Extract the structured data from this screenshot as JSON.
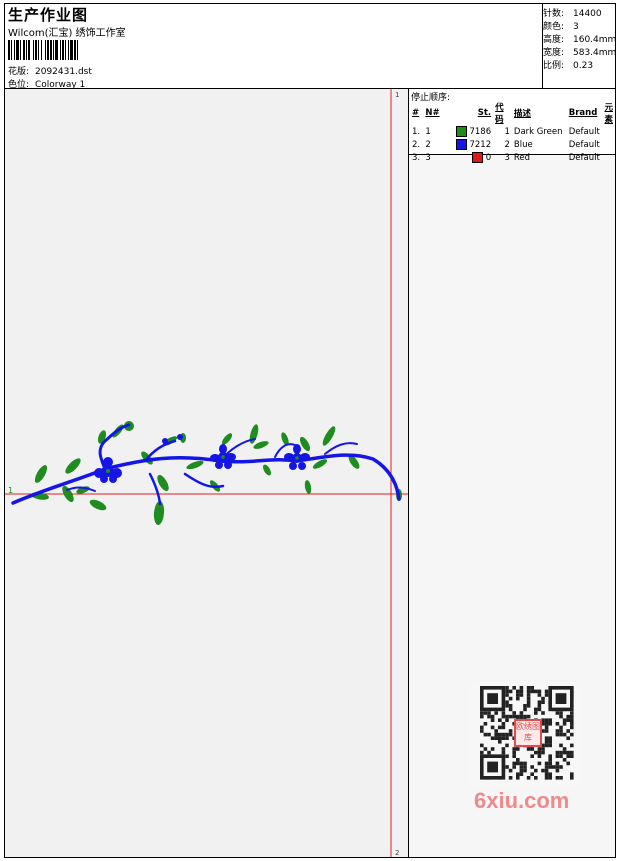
{
  "header": {
    "title": "生产作业图",
    "company": "Wilcom(汇宝) 绣饰工作室",
    "design_label": "花版:",
    "design_value": "2092431.dst",
    "colorway_label": "色位:",
    "colorway_value": "Colorway 1"
  },
  "specs": [
    {
      "label": "针数:",
      "value": "14400"
    },
    {
      "label": "颜色:",
      "value": "3"
    },
    {
      "label": "高度:",
      "value": "160.4mm"
    },
    {
      "label": "宽度:",
      "value": "583.4mm"
    },
    {
      "label": "比例:",
      "value": "0.23"
    }
  ],
  "stop_sequence": {
    "title": "停止顺序:",
    "columns": [
      "#",
      "N#",
      "St.",
      "代码",
      "描述",
      "Brand",
      "元素"
    ],
    "rows": [
      {
        "index": "1.",
        "n": "1",
        "color": "#1e8c1e",
        "stitches": "7186",
        "code": "1",
        "desc": "Dark Green",
        "brand": "Default",
        "element": ""
      },
      {
        "index": "2.",
        "n": "2",
        "color": "#1515e6",
        "stitches": "7212",
        "code": "2",
        "desc": "Blue",
        "brand": "Default",
        "element": ""
      },
      {
        "index": "3.",
        "n": "3",
        "color": "#e01818",
        "stitches": "0",
        "code": "3",
        "desc": "Red",
        "brand": "Default",
        "element": ""
      }
    ]
  },
  "canvas": {
    "start_marker": "1",
    "end_marker": "2",
    "guide_color": "#e02020"
  },
  "watermark": {
    "site": "6xiu.com",
    "stamp": "欧绣图库"
  }
}
